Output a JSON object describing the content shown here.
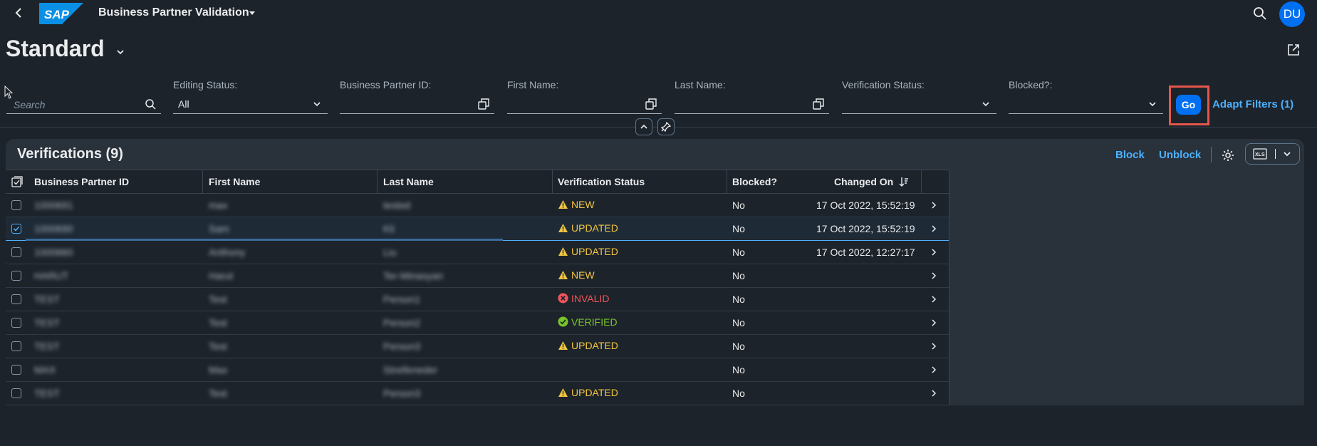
{
  "shell": {
    "title": "Business Partner Validation",
    "logo_text": "SAP",
    "avatar_initials": "DU",
    "brand_color": "#0070f2"
  },
  "variant": {
    "name": "Standard"
  },
  "filters": {
    "search_placeholder": "Search",
    "editing_status": {
      "label": "Editing Status:",
      "value": "All"
    },
    "bp_id": {
      "label": "Business Partner ID:",
      "value": ""
    },
    "first_name": {
      "label": "First Name:",
      "value": ""
    },
    "last_name": {
      "label": "Last Name:",
      "value": ""
    },
    "verification_status": {
      "label": "Verification Status:",
      "value": ""
    },
    "blocked": {
      "label": "Blocked?:",
      "value": ""
    },
    "go_label": "Go",
    "adapt_label": "Adapt Filters (1)"
  },
  "table": {
    "title": "Verifications (9)",
    "block_label": "Block",
    "unblock_label": "Unblock",
    "export_label": "XLS",
    "columns": [
      "Business Partner ID",
      "First Name",
      "Last Name",
      "Verification Status",
      "Blocked?",
      "Changed On"
    ],
    "rows": [
      {
        "id": "1000691",
        "first": "max",
        "last": "tested",
        "status": "NEW",
        "status_type": "warning",
        "blocked": "No",
        "changed": "17 Oct 2022, 15:52:19",
        "selected": false
      },
      {
        "id": "1000690",
        "first": "Sam",
        "last": "Kli",
        "status": "UPDATED",
        "status_type": "warning",
        "blocked": "No",
        "changed": "17 Oct 2022, 15:52:19",
        "selected": true
      },
      {
        "id": "1000660",
        "first": "Anthony",
        "last": "Liu",
        "status": "UPDATED",
        "status_type": "warning",
        "blocked": "No",
        "changed": "17 Oct 2022, 12:27:17",
        "selected": false
      },
      {
        "id": "HARUT",
        "first": "Harut",
        "last": "Ter-Minasyan",
        "status": "NEW",
        "status_type": "warning",
        "blocked": "No",
        "changed": "",
        "selected": false
      },
      {
        "id": "TEST",
        "first": "Test",
        "last": "Person1",
        "status": "INVALID",
        "status_type": "error",
        "blocked": "No",
        "changed": "",
        "selected": false
      },
      {
        "id": "TEST",
        "first": "Test",
        "last": "Person2",
        "status": "VERIFIED",
        "status_type": "success",
        "blocked": "No",
        "changed": "",
        "selected": false
      },
      {
        "id": "TEST",
        "first": "Test",
        "last": "Person3",
        "status": "UPDATED",
        "status_type": "warning",
        "blocked": "No",
        "changed": "",
        "selected": false
      },
      {
        "id": "MAX",
        "first": "Max",
        "last": "Streifeneder",
        "status": "",
        "status_type": "none",
        "blocked": "No",
        "changed": "",
        "selected": false
      },
      {
        "id": "TEST",
        "first": "Test",
        "last": "Person3",
        "status": "UPDATED",
        "status_type": "warning",
        "blocked": "No",
        "changed": "",
        "selected": false
      }
    ]
  },
  "colors": {
    "warning": "#f2c641",
    "error": "#f2545b",
    "success": "#78c42b",
    "link": "#4db1ff",
    "highlight_frame": "#e4574b"
  }
}
